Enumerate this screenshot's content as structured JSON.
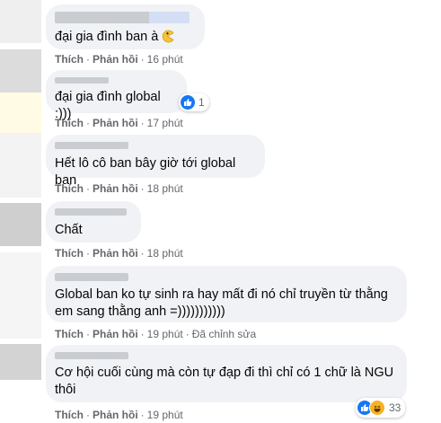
{
  "actions": {
    "like": "Thích",
    "reply": "Phản hồi",
    "dot": "·"
  },
  "comments": [
    {
      "text": "đại gia đình ban à",
      "time": "16 phút"
    },
    {
      "text": "đại gia đình global :)))",
      "time": "17 phút",
      "reaction_count": "1"
    },
    {
      "text": "Hết lô cô ban bây giờ tới global ban",
      "time": "18 phút"
    },
    {
      "text": "Chất",
      "time": "18 phút"
    },
    {
      "text": "Global ban ko tự sinh ra hay mất đi nó chỉ truyền từ thằng em sang thằng anh =)))))))))))",
      "time": "19 phút",
      "edited": "Đã chỉnh sửa"
    },
    {
      "text": "Cơ hội cuối cùng mà còn tự đạp đi thì chỉ có 1 chữ là NGU thôi",
      "time": "19 phút",
      "reaction_count": "33"
    }
  ],
  "colors": {
    "bubble": "#f0f2f5",
    "meta": "#65676b",
    "like_blue": "#1877f2",
    "haha_yellow": "#f7b125"
  }
}
